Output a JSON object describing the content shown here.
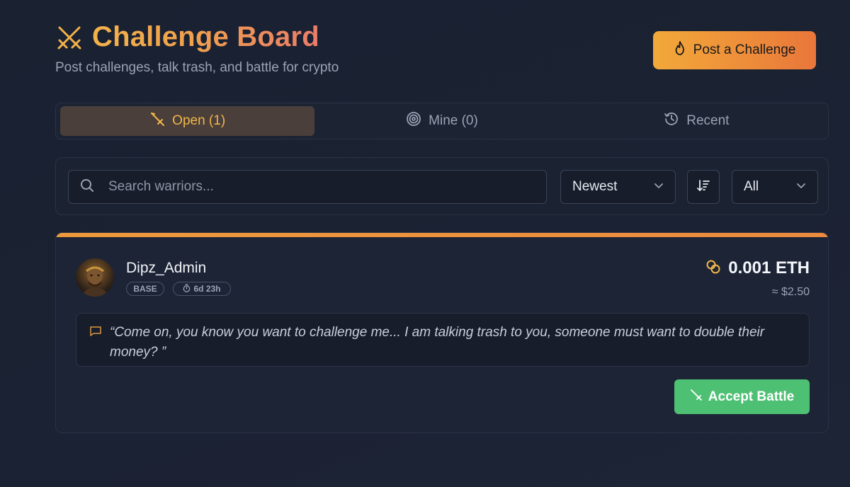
{
  "header": {
    "title": "Challenge Board",
    "subtitle": "Post challenges, talk trash, and battle for crypto",
    "post_button_label": "Post a Challenge"
  },
  "tabs": [
    {
      "label": "Open (1)",
      "icon": "sword-icon",
      "active": true
    },
    {
      "label": "Mine (0)",
      "icon": "target-icon",
      "active": false
    },
    {
      "label": "Recent",
      "icon": "history-icon",
      "active": false
    }
  ],
  "filters": {
    "search_placeholder": "Search warriors...",
    "search_value": "",
    "sort_selected": "Newest",
    "category_selected": "All"
  },
  "challenge": {
    "username": "Dipz_Admin",
    "network_badge": "BASE",
    "time_remaining": "6d 23h",
    "amount": "0.001 ETH",
    "usd_estimate": "≈ $2.50",
    "message": "“Come on, you know you want to challenge me... I am talking trash to you, someone must want to double their money? ”",
    "accept_label": "Accept Battle"
  },
  "colors": {
    "accent_orange": "#ee9a3c",
    "title_gradient_start": "#f2b24a",
    "title_gradient_end": "#ea7d6a",
    "active_tab_bg": "#4a3f3a",
    "active_tab_text": "#f1b64a",
    "accept_green": "#4ec073",
    "background": "#1b2233"
  }
}
